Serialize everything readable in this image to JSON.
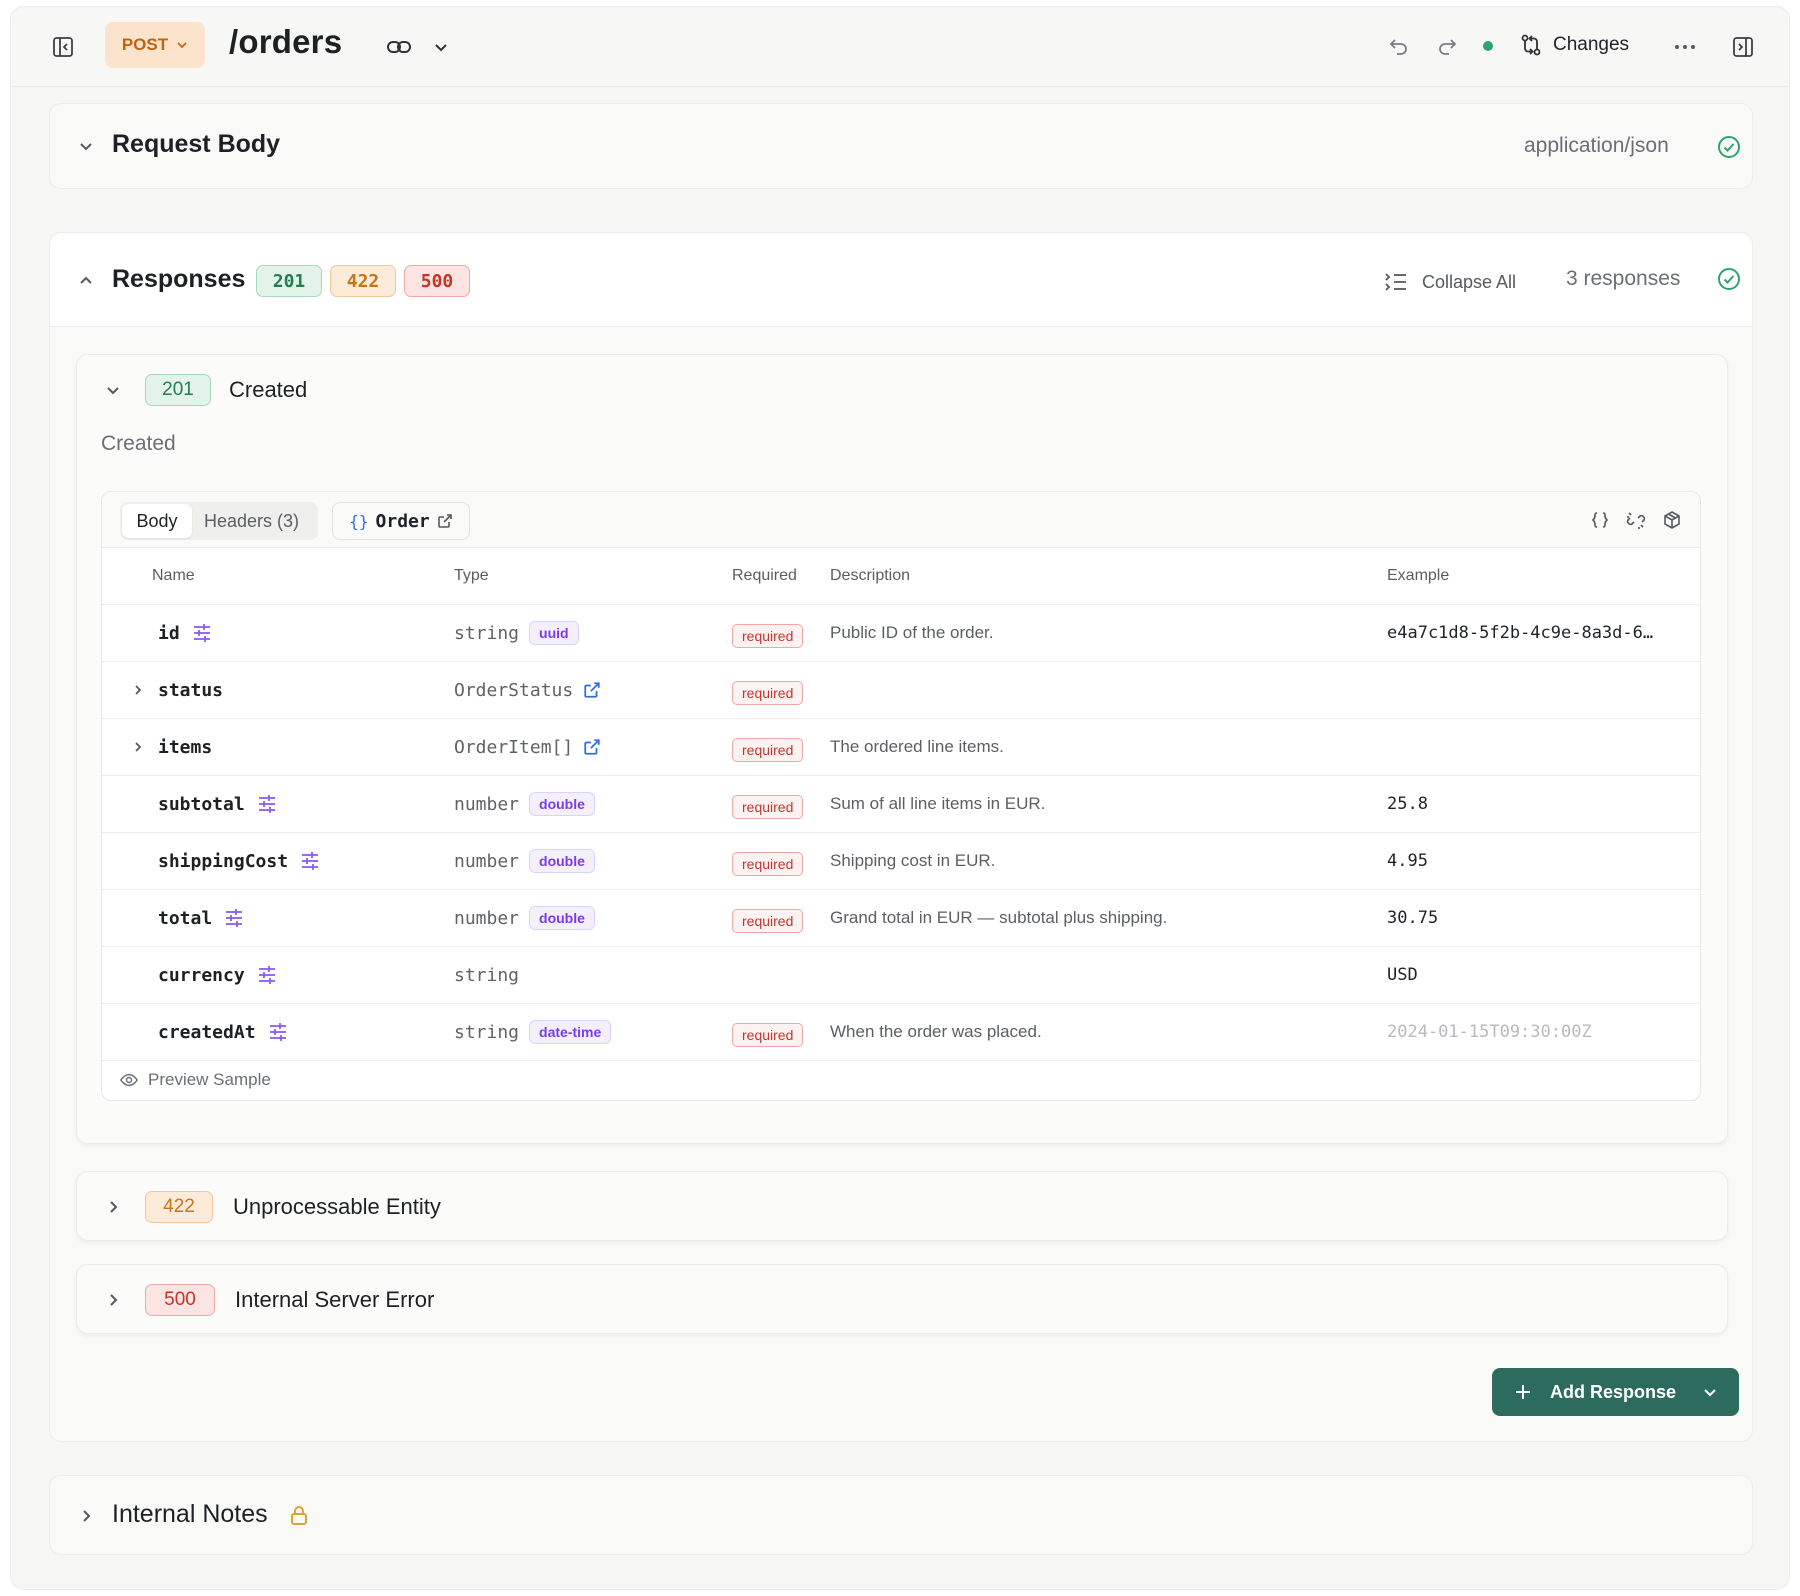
{
  "header": {
    "method": "POST",
    "path": "/orders",
    "changes_label": "Changes"
  },
  "request_body": {
    "title": "Request Body",
    "content_type": "application/json"
  },
  "responses": {
    "title": "Responses",
    "codes": [
      "201",
      "422",
      "500"
    ],
    "collapse_all_label": "Collapse All",
    "count_label": "3 responses",
    "items": [
      {
        "code": "201",
        "title": "Created",
        "description": "Created",
        "tabs": {
          "body": "Body",
          "headers": "Headers (3)",
          "schema_ref_brace": "{}",
          "schema_ref": "Order"
        },
        "columns": {
          "name": "Name",
          "type": "Type",
          "required": "Required",
          "description": "Description",
          "example": "Example"
        },
        "fields": [
          {
            "name": "id",
            "type": "string",
            "format": "uuid",
            "required": "required",
            "description": "Public ID of the order.",
            "example": "e4a7c1d8-5f2b-4c9e-8a3d-6…"
          },
          {
            "name": "status",
            "type": "OrderStatus",
            "format": "",
            "required": "required",
            "description": "",
            "example": ""
          },
          {
            "name": "items",
            "type": "OrderItem[]",
            "format": "",
            "required": "required",
            "description": "The ordered line items.",
            "example": ""
          },
          {
            "name": "subtotal",
            "type": "number",
            "format": "double",
            "required": "required",
            "description": "Sum of all line items in EUR.",
            "example": "25.8"
          },
          {
            "name": "shippingCost",
            "type": "number",
            "format": "double",
            "required": "required",
            "description": "Shipping cost in EUR.",
            "example": "4.95"
          },
          {
            "name": "total",
            "type": "number",
            "format": "double",
            "required": "required",
            "description": "Grand total in EUR — subtotal plus shipping.",
            "example": "30.75"
          },
          {
            "name": "currency",
            "type": "string",
            "format": "",
            "required": "",
            "description": "",
            "example": "USD"
          },
          {
            "name": "createdAt",
            "type": "string",
            "format": "date-time",
            "required": "required",
            "description": "When the order was placed.",
            "example": "2024-01-15T09:30:00Z"
          }
        ],
        "preview_label": "Preview Sample"
      },
      {
        "code": "422",
        "title": "Unprocessable Entity"
      },
      {
        "code": "500",
        "title": "Internal Server Error"
      }
    ],
    "add_button_label": "Add Response"
  },
  "internal_notes": {
    "title": "Internal Notes"
  },
  "colors": {
    "accent_green": "#2c6b5e",
    "status_201": "#22804f",
    "status_422": "#c97218",
    "status_500": "#c6352b",
    "format_purple": "#7c3aed",
    "method_orange": "#c2620f"
  }
}
